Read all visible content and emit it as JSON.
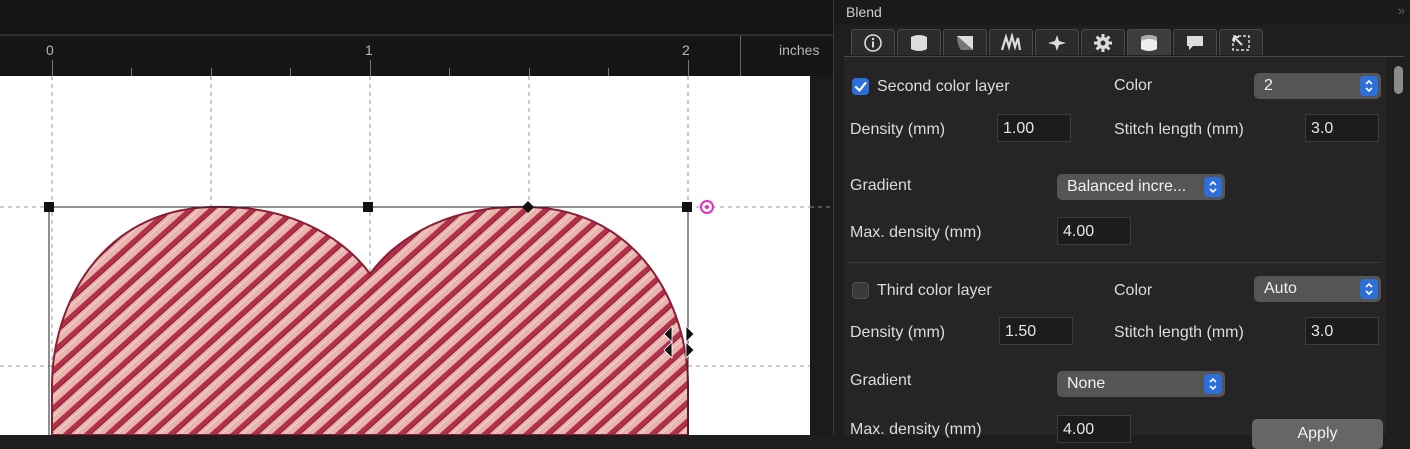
{
  "ruler": {
    "ticks": [
      "0",
      "1",
      "2"
    ],
    "units": "inches"
  },
  "panel": {
    "title": "Blend",
    "tabs": [
      {
        "icon": "info-icon"
      },
      {
        "icon": "fill-shape-icon"
      },
      {
        "icon": "gradient-fill-icon"
      },
      {
        "icon": "stitch-effect-icon"
      },
      {
        "icon": "motif-icon"
      },
      {
        "icon": "gear-icon"
      },
      {
        "icon": "blend-icon",
        "active": true
      },
      {
        "icon": "comment-icon"
      },
      {
        "icon": "resize-icon"
      }
    ],
    "second_layer": {
      "label": "Second color layer",
      "checked": true,
      "color_label": "Color",
      "color_value": "2",
      "density_label": "Density (mm)",
      "density_value": "1.00",
      "stitch_label": "Stitch length (mm)",
      "stitch_value": "3.0",
      "gradient_label": "Gradient",
      "gradient_value": "Balanced incre...",
      "max_density_label": "Max. density (mm)",
      "max_density_value": "4.00"
    },
    "third_layer": {
      "label": "Third color layer",
      "checked": false,
      "color_label": "Color",
      "color_value": "Auto",
      "density_label": "Density (mm)",
      "density_value": "1.50",
      "stitch_label": "Stitch length (mm)",
      "stitch_value": "3.0",
      "gradient_label": "Gradient",
      "gradient_value": "None",
      "max_density_label": "Max. density (mm)",
      "max_density_value": "4.00"
    },
    "apply_label": "Apply"
  },
  "colors": {
    "accent": "#2d6fd9",
    "heart_base": "#e7b5ad",
    "heart_stitch": "#b3304a",
    "selection_handle": "#111111",
    "rotate_handle": "#e030c0"
  }
}
